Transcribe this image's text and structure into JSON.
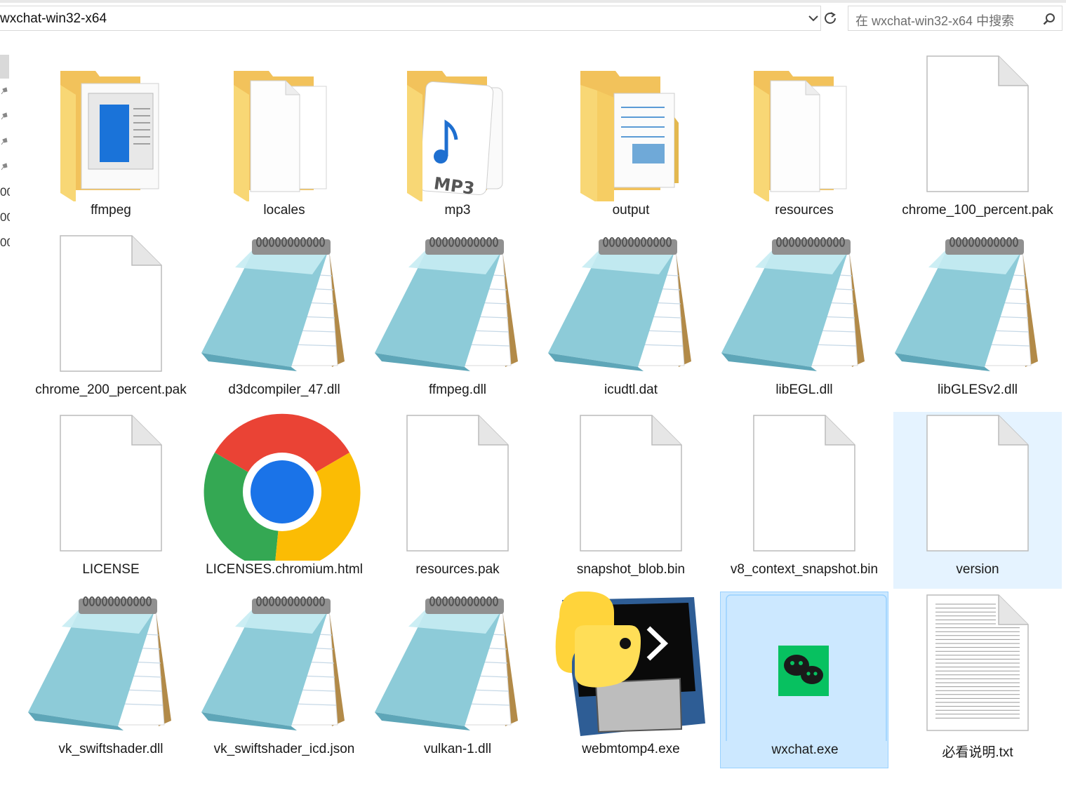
{
  "address": {
    "path": "wxchat-win32-x64"
  },
  "search": {
    "placeholder": "在 wxchat-win32-x64 中搜索"
  },
  "nav": {
    "fragments": [
      "00",
      "00",
      "00"
    ]
  },
  "items": [
    {
      "name": "ffmpeg",
      "type": "folder",
      "icon": "folder-preview-document-icon"
    },
    {
      "name": "locales",
      "type": "folder",
      "icon": "folder-files-icon"
    },
    {
      "name": "mp3",
      "type": "folder",
      "icon": "folder-mp3-icon"
    },
    {
      "name": "output",
      "type": "folder",
      "icon": "folder-documents-icon"
    },
    {
      "name": "resources",
      "type": "folder",
      "icon": "folder-files-icon"
    },
    {
      "name": "chrome_100_percent.pak",
      "type": "file",
      "icon": "blank-file-icon"
    },
    {
      "name": "chrome_200_percent.pak",
      "type": "file",
      "icon": "blank-file-icon"
    },
    {
      "name": "d3dcompiler_47.dll",
      "type": "file",
      "icon": "notepad-icon"
    },
    {
      "name": "ffmpeg.dll",
      "type": "file",
      "icon": "notepad-icon"
    },
    {
      "name": "icudtl.dat",
      "type": "file",
      "icon": "notepad-icon"
    },
    {
      "name": "libEGL.dll",
      "type": "file",
      "icon": "notepad-icon"
    },
    {
      "name": "libGLESv2.dll",
      "type": "file",
      "icon": "notepad-icon"
    },
    {
      "name": "LICENSE",
      "type": "file",
      "icon": "blank-file-icon"
    },
    {
      "name": "LICENSES.chromium.html",
      "type": "file",
      "icon": "chrome-icon"
    },
    {
      "name": "resources.pak",
      "type": "file",
      "icon": "blank-file-icon"
    },
    {
      "name": "snapshot_blob.bin",
      "type": "file",
      "icon": "blank-file-icon"
    },
    {
      "name": "v8_context_snapshot.bin",
      "type": "file",
      "icon": "blank-file-icon"
    },
    {
      "name": "version",
      "type": "file",
      "icon": "blank-file-icon",
      "state": "hover"
    },
    {
      "name": "vk_swiftshader.dll",
      "type": "file",
      "icon": "notepad-icon"
    },
    {
      "name": "vk_swiftshader_icd.json",
      "type": "file",
      "icon": "notepad-icon"
    },
    {
      "name": "vulkan-1.dll",
      "type": "file",
      "icon": "notepad-icon"
    },
    {
      "name": "webmtomp4.exe",
      "type": "file",
      "icon": "python-launcher-icon"
    },
    {
      "name": "wxchat.exe",
      "type": "file",
      "icon": "wechat-icon",
      "state": "selected"
    },
    {
      "name": "必看说明.txt",
      "type": "file",
      "icon": "text-file-icon"
    }
  ],
  "colors": {
    "hover_bg": "#e5f3ff",
    "selected_bg": "#cce8ff",
    "selected_border": "#99d1ff",
    "folder": "#f8d775",
    "wechat_green": "#07c160"
  }
}
